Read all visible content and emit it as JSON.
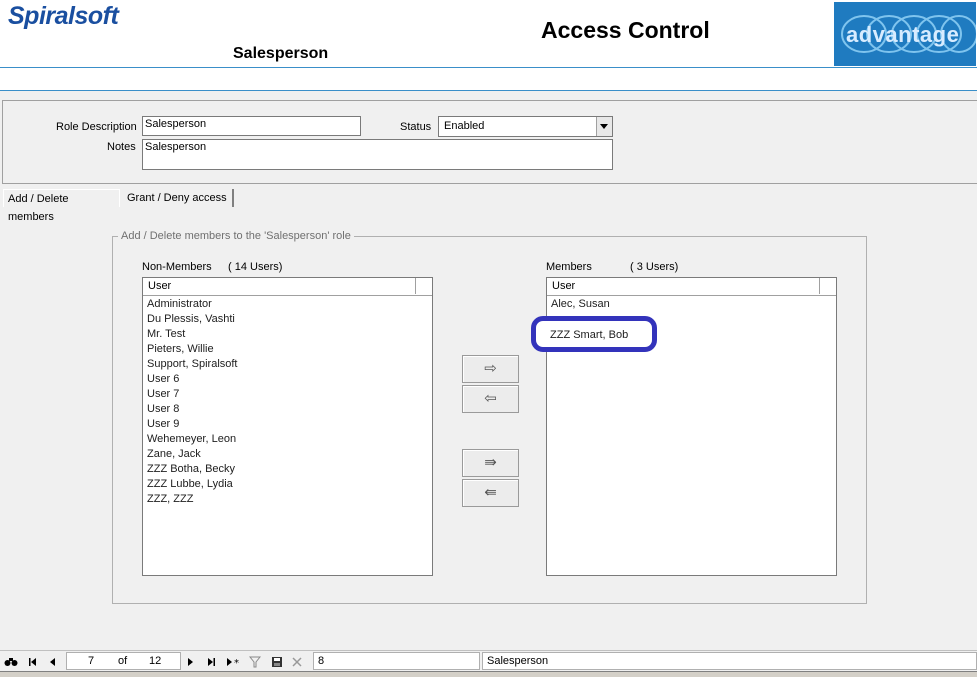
{
  "header": {
    "logo": "Spiralsoft",
    "role_name": "Salesperson",
    "title": "Access Control",
    "brand_badge": "advantage"
  },
  "form": {
    "role_description_label": "Role Description",
    "role_description_value": "Salesperson",
    "status_label": "Status",
    "status_value": "Enabled",
    "notes_label": "Notes",
    "notes_value": "Salesperson"
  },
  "tabs": [
    {
      "label": "Add / Delete members",
      "active": true
    },
    {
      "label": "Grant / Deny access",
      "active": false
    }
  ],
  "group": {
    "title": "Add / Delete members to the 'Salesperson' role",
    "non_members_label": "Non-Members",
    "non_members_count": "( 14 Users)",
    "members_label": "Members",
    "members_count": "( 3 Users)",
    "column_header": "User"
  },
  "non_members": [
    "Administrator",
    "Du Plessis, Vashti",
    "Mr. Test",
    "Pieters, Willie",
    "Support, Spiralsoft",
    "User 6",
    "User 7",
    "User 8",
    "User 9",
    "Wehemeyer, Leon",
    "Zane, Jack",
    "ZZZ Botha, Becky",
    "ZZZ Lubbe, Lydia",
    "ZZZ, ZZZ"
  ],
  "members": [
    "Alec, Susan",
    "ZZZ Smart, Bob"
  ],
  "highlighted_member": "ZZZ Smart, Bob",
  "move_buttons": {
    "add_one": "⇨",
    "remove_one": "⇦",
    "add_all": "⇛",
    "remove_all": "⇚"
  },
  "navigator": {
    "current_record": "7",
    "of_label": "of",
    "total_records": "12",
    "record_id": "8",
    "record_name": "Salesperson"
  },
  "colors": {
    "logo": "#1a4fa0",
    "badge": "#1f7bc0",
    "highlight": "#3333bb",
    "divider": "#3a8fc9"
  }
}
